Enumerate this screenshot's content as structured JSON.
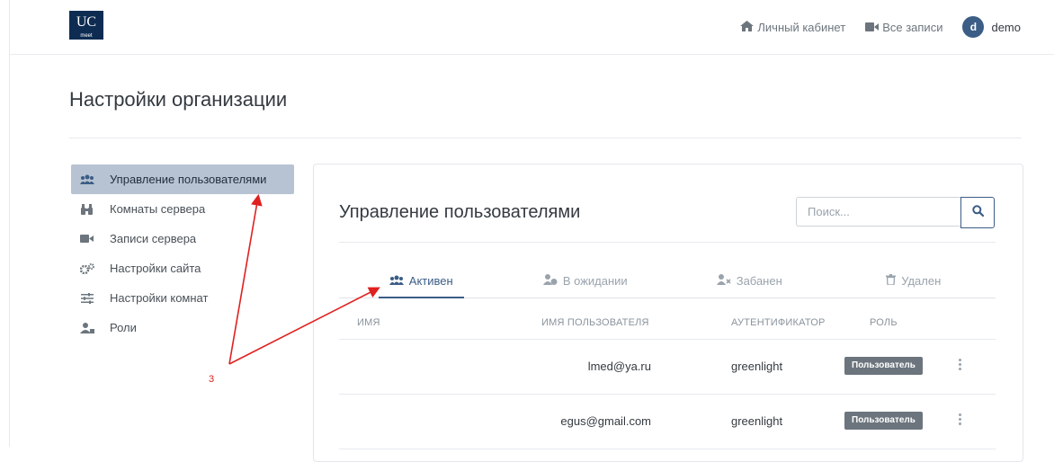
{
  "header": {
    "logo_text": "UC",
    "logo_subtext": "meet",
    "nav": [
      {
        "label": "Личный кабинет",
        "icon": "home-icon"
      },
      {
        "label": "Все записи",
        "icon": "video-camera-icon"
      }
    ],
    "user": {
      "avatar_letter": "d",
      "name": "demo"
    }
  },
  "page": {
    "title": "Настройки организации"
  },
  "sidebar": {
    "items": [
      {
        "label": "Управление пользователями",
        "icon": "users-icon",
        "active": true
      },
      {
        "label": "Комнаты сервера",
        "icon": "binoculars-icon",
        "active": false
      },
      {
        "label": "Записи сервера",
        "icon": "video-camera-icon",
        "active": false
      },
      {
        "label": "Настройки сайта",
        "icon": "cogs-icon",
        "active": false
      },
      {
        "label": "Настройки комнат",
        "icon": "sliders-icon",
        "active": false
      },
      {
        "label": "Роли",
        "icon": "user-role-icon",
        "active": false
      }
    ]
  },
  "main": {
    "title": "Управление пользователями",
    "search": {
      "placeholder": "Поиск...",
      "value": ""
    },
    "tabs": [
      {
        "label": "Активен",
        "icon": "users-icon",
        "active": true
      },
      {
        "label": "В ожидании",
        "icon": "user-clock-icon",
        "active": false
      },
      {
        "label": "Забанен",
        "icon": "user-times-icon",
        "active": false
      },
      {
        "label": "Удален",
        "icon": "trash-icon",
        "active": false
      }
    ],
    "columns": [
      "Имя",
      "Имя пользователя",
      "Аутентификатор",
      "Роль"
    ],
    "rows": [
      {
        "name": "",
        "username": "lmed@ya.ru",
        "authenticator": "greenlight",
        "role": "Пользователь"
      },
      {
        "name": "",
        "username": "egus@gmail.com",
        "authenticator": "greenlight",
        "role": "Пользователь"
      }
    ]
  },
  "annotation": {
    "number": "3",
    "color": "#e02020"
  },
  "colors": {
    "accent": "#3b5d86",
    "active_sidebar_bg": "#b7c3d2",
    "badge_bg": "#6c757d"
  }
}
